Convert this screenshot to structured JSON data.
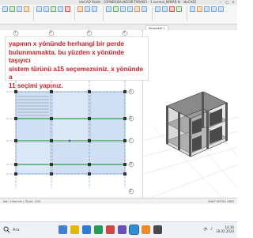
{
  "window": {
    "title": "ideCAD Statik - [ORNEK-BALIKESIR-TARAKCI - 1.normal_MIMAR-N - ideCAD]"
  },
  "tabs": [
    {
      "label": "Perspektif 1"
    }
  ],
  "plan": {
    "column_labels": [
      "1",
      "2",
      "3",
      "4"
    ],
    "row_labels": [
      "A",
      "B",
      "C",
      "D",
      "E"
    ]
  },
  "note": {
    "lines": [
      "yapının x yönünde herhangi bir perde",
      "bulunmamakta. bu yüzden x yönünde taşıyıcı",
      "sistem türünü a15 seçemezsiniz. x yönünde a",
      "11 seçimi yapınız."
    ]
  },
  "status": {
    "left": "Kat: 1.Normal  |  Ölçek: 1/50",
    "right": "SNAP  ORTHO  GRID"
  },
  "taskbar": {
    "search_placeholder": "Ara",
    "time": "14:36",
    "date": "18.02.2024"
  },
  "colors": {
    "note_text": "#d61f26",
    "grid_axis": "#1a5fb4",
    "beam_green": "#2e9e4a",
    "slab_blue": "#a9c7ea"
  }
}
